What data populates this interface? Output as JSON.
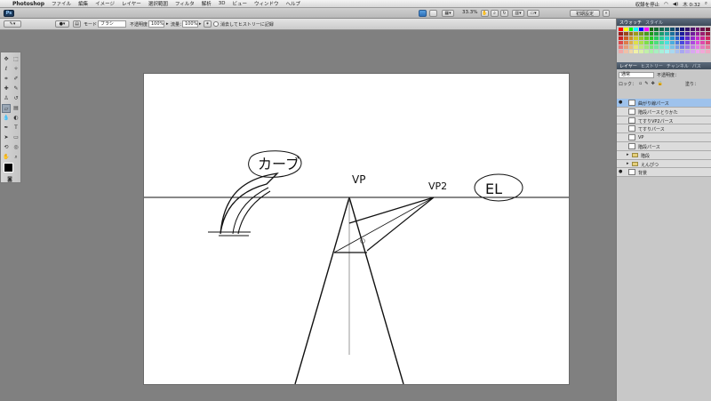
{
  "menubar": {
    "app": "Photoshop",
    "items": [
      "ファイル",
      "編集",
      "イメージ",
      "レイヤー",
      "選択範囲",
      "フィルタ",
      "解析",
      "3D",
      "ビュー",
      "ウィンドウ",
      "ヘルプ"
    ],
    "status": "収録を停止",
    "clock": "木 0:32"
  },
  "appbar": {
    "zoom": "33.3%",
    "workspace": "初期設定"
  },
  "options": {
    "mode_label": "モード：",
    "mode_value": "ブラシ",
    "opacity_label": "不透明度：",
    "opacity_value": "100%",
    "flow_label": "流量：",
    "flow_value": "100%",
    "history_label": "消去してヒストリーに記録"
  },
  "swatch_panel": {
    "tabs": [
      "スウォッチ",
      "スタイル"
    ]
  },
  "layers_panel": {
    "tabs": [
      "レイヤー",
      "ヒストリー",
      "チャンネル",
      "パス"
    ],
    "blend": "通常",
    "opacity_label": "不透明度：",
    "lock_label": "ロック：",
    "fill_label": "塗り：",
    "layers": [
      {
        "name": "曲がり線パース",
        "selected": true,
        "visible": true,
        "type": "layer"
      },
      {
        "name": "階段パースとりかた",
        "selected": false,
        "visible": false,
        "type": "layer"
      },
      {
        "name": "てすりVP2パース",
        "selected": false,
        "visible": false,
        "type": "layer"
      },
      {
        "name": "てすりパース",
        "selected": false,
        "visible": false,
        "type": "layer"
      },
      {
        "name": "VP",
        "selected": false,
        "visible": false,
        "type": "layer"
      },
      {
        "name": "階段パース",
        "selected": false,
        "visible": false,
        "type": "layer"
      },
      {
        "name": "階段",
        "selected": false,
        "visible": false,
        "type": "folder"
      },
      {
        "name": "えんぴつ",
        "selected": false,
        "visible": false,
        "type": "folder"
      },
      {
        "name": "背景",
        "selected": false,
        "visible": true,
        "type": "layer"
      }
    ]
  },
  "canvas": {
    "labels": {
      "curve": "カーブ",
      "vp": "VP",
      "vp2": "VP2",
      "el": "EL"
    }
  },
  "colors": {
    "panel_header": "#4a5766",
    "selected_layer": "#9ec2ec",
    "foreground": "#000000",
    "background": "#ffffff"
  }
}
